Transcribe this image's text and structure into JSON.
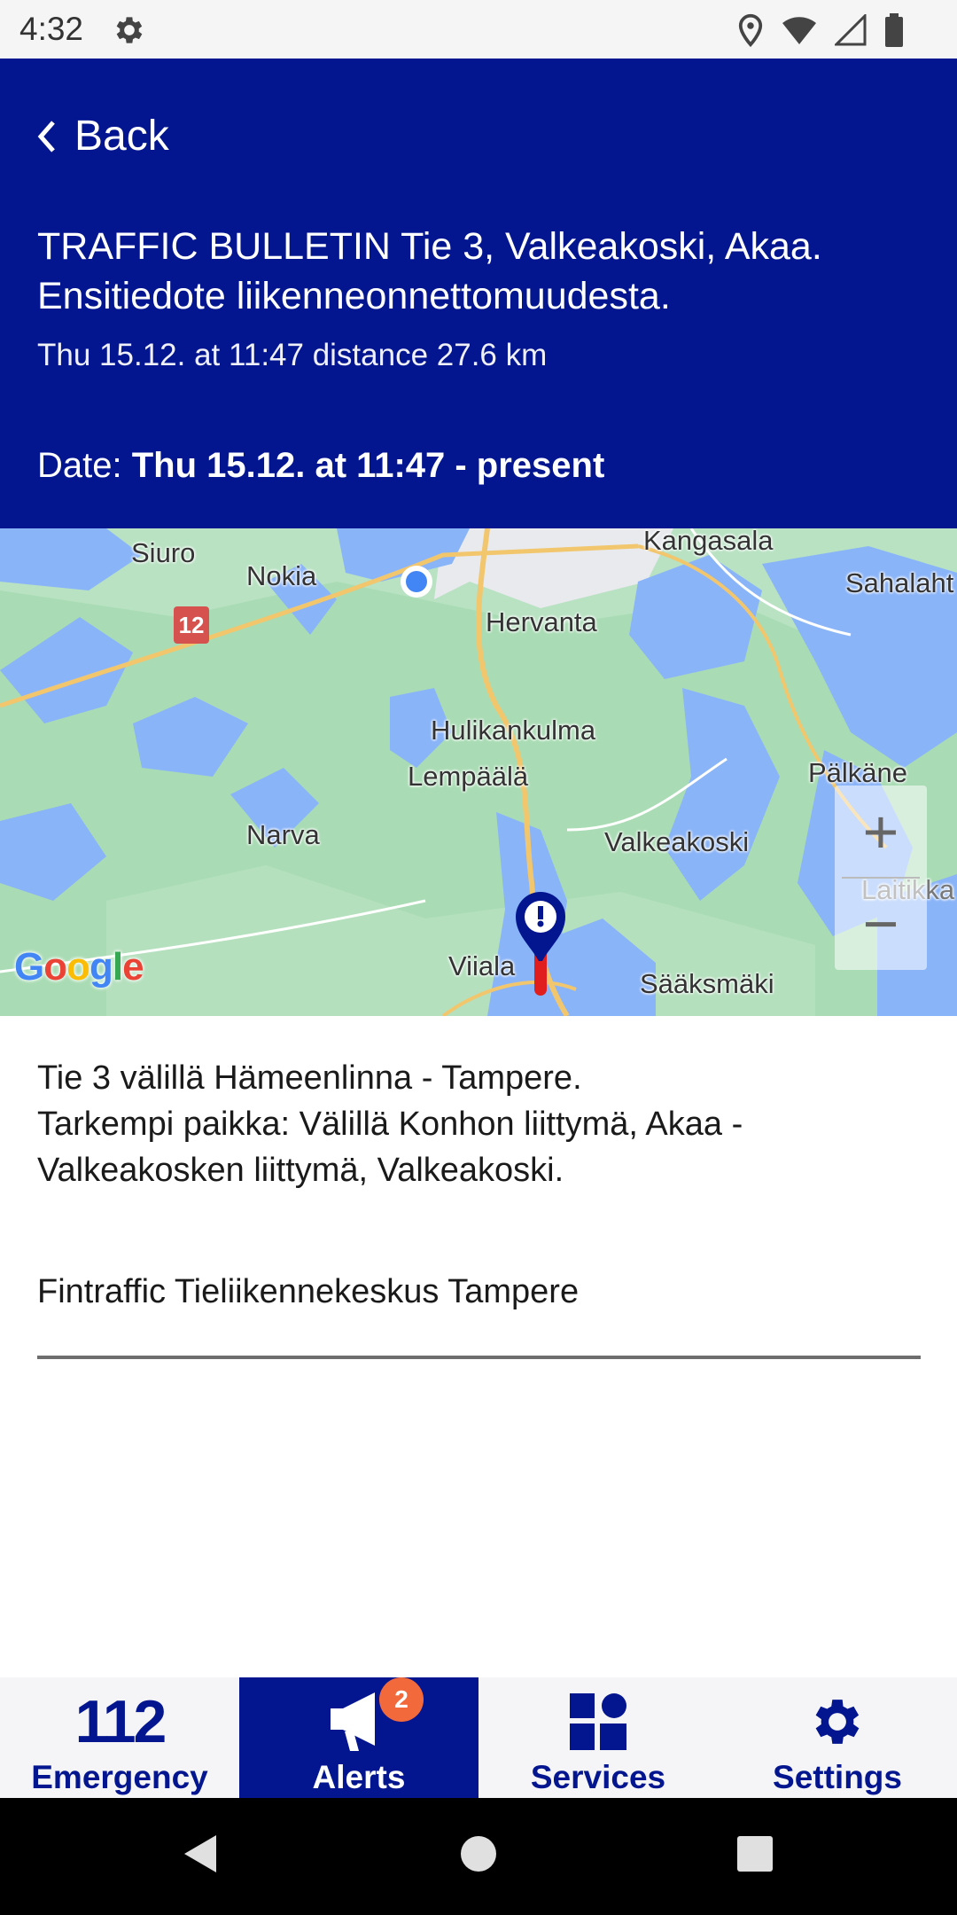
{
  "status_bar": {
    "time": "4:32",
    "icons": [
      "settings-gear-icon",
      "location-icon",
      "wifi-icon",
      "signal-icon",
      "battery-icon"
    ]
  },
  "header": {
    "back_label": "Back",
    "headline": "TRAFFIC BULLETIN Tie 3, Valkeakoski, Akaa. Ensitiedote liikenneonnettomuudesta.",
    "meta": "Thu 15.12. at 11:47 distance 27.6 km",
    "date_label": "Date:",
    "date_value": "Thu 15.12. at 11:47 - present",
    "background_color": "#04168f"
  },
  "map": {
    "places": [
      "Siuro",
      "Nokia",
      "Kangasala",
      "Sahalaht",
      "Hervanta",
      "Hulikankulma",
      "Lempäälä",
      "Pälkäne",
      "Narva",
      "Valkeakoski",
      "Laitikka",
      "Viiala",
      "Sääksmäki"
    ],
    "road_number": "12",
    "zoom_in": "+",
    "zoom_out": "−",
    "attribution": "Google"
  },
  "content": {
    "line1": "Tie 3 välillä Hämeenlinna - Tampere.",
    "line2": "Tarkempi paikka: Välillä Konhon liittymä, Akaa - Valkeakosken liittymä, Valkeakoski.",
    "source": "Fintraffic Tieliikennekeskus Tampere"
  },
  "bottom_nav": {
    "items": [
      {
        "label": "Emergency",
        "icon_text": "112",
        "active": false
      },
      {
        "label": "Alerts",
        "icon": "megaphone-icon",
        "badge": "2",
        "active": true
      },
      {
        "label": "Services",
        "icon": "grid-icon",
        "active": false
      },
      {
        "label": "Settings",
        "icon": "gear-icon",
        "active": false
      }
    ],
    "active_color": "#04168f",
    "badge_color": "#f26a3c"
  }
}
